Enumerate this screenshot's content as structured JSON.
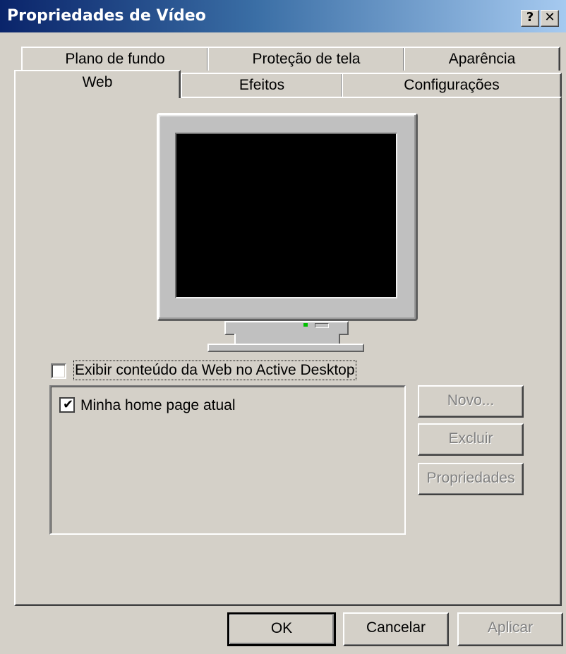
{
  "window": {
    "title": "Propriedades de Vídeo",
    "help_label": "?",
    "close_label": "✕"
  },
  "tabs": {
    "row_back": [
      "Plano de fundo",
      "Proteção de tela",
      "Aparência"
    ],
    "row_front": [
      "Web",
      "Efeitos",
      "Configurações"
    ],
    "active": "Web"
  },
  "web": {
    "show_web_content_label": "Exibir conteúdo da Web no Active Desktop",
    "show_web_content_checked": false,
    "items": [
      {
        "label": "Minha home page atual",
        "checked": true
      }
    ],
    "checkmark": "✔",
    "buttons": {
      "new": "Novo...",
      "delete": "Excluir",
      "properties": "Propriedades"
    }
  },
  "footer": {
    "ok": "OK",
    "cancel": "Cancelar",
    "apply": "Aplicar"
  },
  "colors": {
    "face": "#d4d0c8",
    "title_start": "#0a246a",
    "title_end": "#a6caf0",
    "disabled_text": "#808080"
  }
}
